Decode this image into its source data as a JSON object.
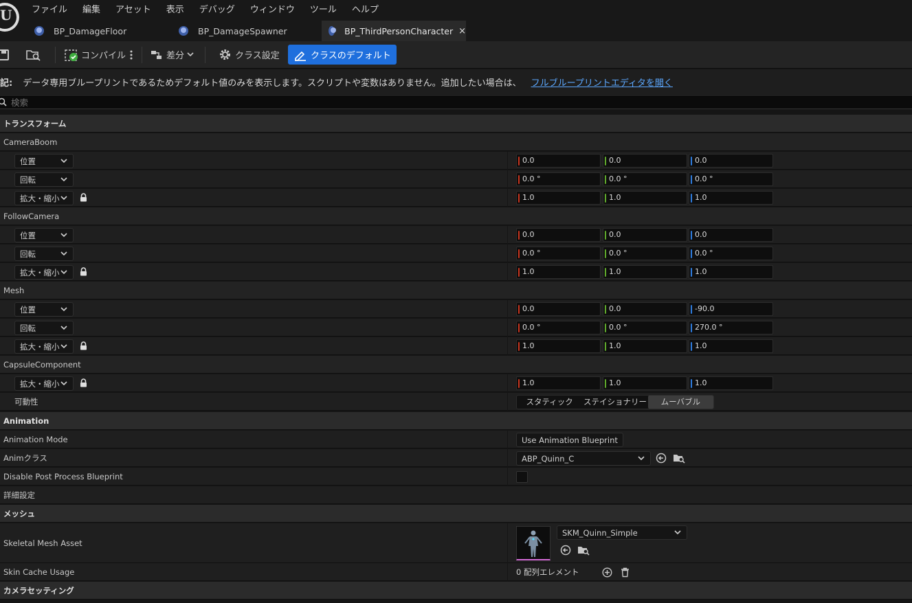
{
  "menubar": {
    "items": [
      "ファイル",
      "編集",
      "アセット",
      "表示",
      "デバッグ",
      "ウィンドウ",
      "ツール",
      "ヘルプ"
    ]
  },
  "tabs": [
    {
      "label": "BP_DamageFloor",
      "active": false
    },
    {
      "label": "BP_DamageSpawner",
      "active": false
    },
    {
      "label": "BP_ThirdPersonCharacter",
      "active": true
    }
  ],
  "tab_close_glyph": "×",
  "toolbar": {
    "compile_label": "コンパイル",
    "diff_label": "差分",
    "class_settings_label": "クラス設定",
    "class_defaults_label": "クラスのデフォルト"
  },
  "notice": {
    "prefix": "記:",
    "message": "データ専用ブループリントであるためデフォルト値のみを表示します。スクリプトや変数はありません。追加したい場合は、",
    "link": "フルブループリントエディタを開く"
  },
  "search": {
    "placeholder": "検索"
  },
  "details": {
    "transform_category": "トランスフォーム",
    "location_label": "位置",
    "rotation_label": "回転",
    "scale_label": "拡大・縮小",
    "components": [
      {
        "name": "CameraBoom",
        "location": [
          "0.0",
          "0.0",
          "0.0"
        ],
        "rotation": [
          "0.0 °",
          "0.0 °",
          "0.0 °"
        ],
        "scale": [
          "1.0",
          "1.0",
          "1.0"
        ]
      },
      {
        "name": "FollowCamera",
        "location": [
          "0.0",
          "0.0",
          "0.0"
        ],
        "rotation": [
          "0.0 °",
          "0.0 °",
          "0.0 °"
        ],
        "scale": [
          "1.0",
          "1.0",
          "1.0"
        ]
      },
      {
        "name": "Mesh",
        "location": [
          "0.0",
          "0.0",
          "-90.0"
        ],
        "rotation": [
          "0.0 °",
          "0.0 °",
          "270.0 °"
        ],
        "scale": [
          "1.0",
          "1.0",
          "1.0"
        ]
      }
    ],
    "capsule": {
      "name": "CapsuleComponent",
      "scale": [
        "1.0",
        "1.0",
        "1.0"
      ]
    },
    "mobility": {
      "label": "可動性",
      "options": [
        "スタティック",
        "ステイショナリー",
        "ムーバブル"
      ],
      "selected": "ムーバブル"
    },
    "animation": {
      "category": "Animation",
      "mode_label": "Animation Mode",
      "mode_value": "Use Animation Blueprint",
      "anim_class_label": "Animクラス",
      "anim_class_value": "ABP_Quinn_C",
      "disable_pp_label": "Disable Post Process Blueprint",
      "disable_pp_checked": false,
      "advanced_label": "詳細設定"
    },
    "mesh_section": {
      "category": "メッシュ",
      "skeletal_label": "Skeletal Mesh Asset",
      "skeletal_value": "SKM_Quinn_Simple",
      "skin_cache_label": "Skin Cache Usage",
      "skin_cache_value": "0 配列エレメント"
    },
    "camera_category": "カメラセッティング"
  },
  "colors": {
    "accent": "#1f6fdd",
    "axis_x": "#c8341e",
    "axis_y": "#5fa82c",
    "axis_z": "#2f7ee0",
    "link": "#5ca8ff"
  }
}
